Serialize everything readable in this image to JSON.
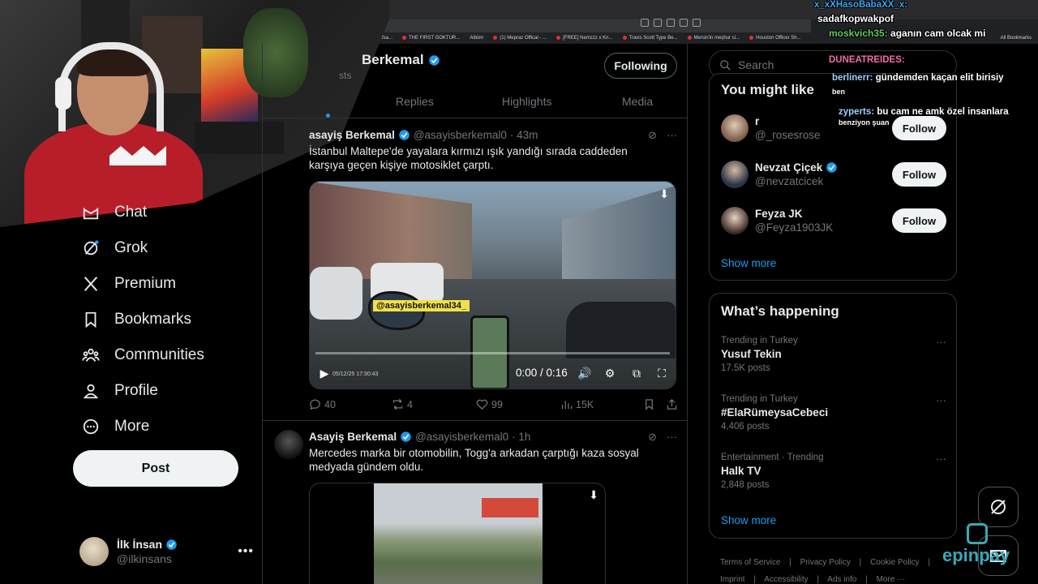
{
  "bookmarks": [
    "Bir Efsa...",
    "THE FIRST GOKTUR...",
    "Albüm",
    "(1) Mepraz Offical - ...",
    "[FREE] Nemzzz x Kn...",
    "Travis Scott Type Be...",
    "Mersin'in meşhur ci...",
    "Houston Officer Sh...",
    "All Bookmarks"
  ],
  "nav": {
    "items": [
      {
        "label": "Chat",
        "icon": "chat-icon"
      },
      {
        "label": "Grok",
        "icon": "grok-icon"
      },
      {
        "label": "Premium",
        "icon": "x-logo-icon"
      },
      {
        "label": "Bookmarks",
        "icon": "bookmark-icon"
      },
      {
        "label": "Communities",
        "icon": "communities-icon"
      },
      {
        "label": "Profile",
        "icon": "profile-icon"
      },
      {
        "label": "More",
        "icon": "more-circle-icon"
      }
    ],
    "post_label": "Post"
  },
  "account": {
    "name": "İlk İnsan",
    "handle": "@ilkinsans",
    "more": "•••"
  },
  "profile": {
    "name": "Berkemal",
    "posts": "sts",
    "following_label": "Following"
  },
  "tabs": [
    "Replies",
    "Highlights",
    "Media"
  ],
  "tweets": [
    {
      "name": "asayiş Berkemal",
      "handle": "@asayisberkemal0",
      "time": "· 43m",
      "text": "İstanbul Maltepe'de yayalara kırmızı ışık yandığı sırada caddeden karşıya geçen kişiye motosiklet çarptı.",
      "video_tag": "@asayisberkemal34_",
      "video_time": "0:00 / 0:16",
      "video_date": "05/12/25  17:30:43",
      "stats": {
        "replies": "40",
        "reposts": "4",
        "likes": "99",
        "views": "15K"
      }
    },
    {
      "name": "Asayiş Berkemal",
      "handle": "@asayisberkemal0",
      "time": "· 1h",
      "text": "Mercedes marka bir otomobilin, Togg'a arkadan çarptığı kaza sosyal medyada gündem oldu."
    }
  ],
  "search": {
    "placeholder": "Search"
  },
  "who_to_follow": {
    "title": "You might like",
    "users": [
      {
        "name": "r",
        "handle": "@_rosesrose",
        "button": "Follow",
        "verified": false
      },
      {
        "name": "Nevzat Çiçek",
        "handle": "@nevzatcicek",
        "button": "Follow",
        "verified": true
      },
      {
        "name": "Feyza JK",
        "handle": "@Feyza1903JK",
        "button": "Follow",
        "verified": false
      }
    ],
    "show_more": "Show more"
  },
  "trends": {
    "title": "What’s happening",
    "items": [
      {
        "meta": "Trending in Turkey",
        "name": "Yusuf Tekin",
        "count": "17.5K posts"
      },
      {
        "meta": "Trending in Turkey",
        "name": "#ElaRümeysaCebeci",
        "count": "4,406 posts"
      },
      {
        "meta": "Entertainment · Trending",
        "name": "Halk TV",
        "count": "2,848 posts"
      }
    ],
    "show_more": "Show more"
  },
  "footer": {
    "line1": [
      "Terms of Service",
      "|",
      "Privacy Policy",
      "|",
      "Cookie Policy",
      "|"
    ],
    "line2": [
      "Imprint",
      "|",
      "Accessibility",
      "|",
      "Ads info",
      "|",
      "More ···"
    ]
  },
  "chat": [
    {
      "user": "x_xXHasoBabaXX_x:",
      "msg": "",
      "color": "#3ba7f0"
    },
    {
      "user": "sadafkopwakpof",
      "msg": "",
      "color": "#ffffff"
    },
    {
      "user": "moskvich35:",
      "msg": "aganın cam olcak mi",
      "color": "#5ecb5e"
    },
    {
      "user": "DUNEATREIDES:",
      "msg": "",
      "color": "#f06aa8"
    },
    {
      "user": "berlinerr:",
      "msg": "gündemden kaçan elit birisiy",
      "color": "#9ad0ff"
    },
    {
      "user": "",
      "msg": "ben",
      "color": "#ffffff"
    },
    {
      "user": "zyperts:",
      "msg": "bu cam ne amk özel insanlara",
      "color": "#9ad0ff"
    },
    {
      "user": "",
      "msg": "benziyon şuan",
      "color": "#ffffff"
    }
  ],
  "overlay": {
    "brand": "epinpay"
  },
  "colors": {
    "accent": "#1d9bf0",
    "bg": "#000000",
    "border": "#2f3336",
    "muted": "#71767b"
  }
}
